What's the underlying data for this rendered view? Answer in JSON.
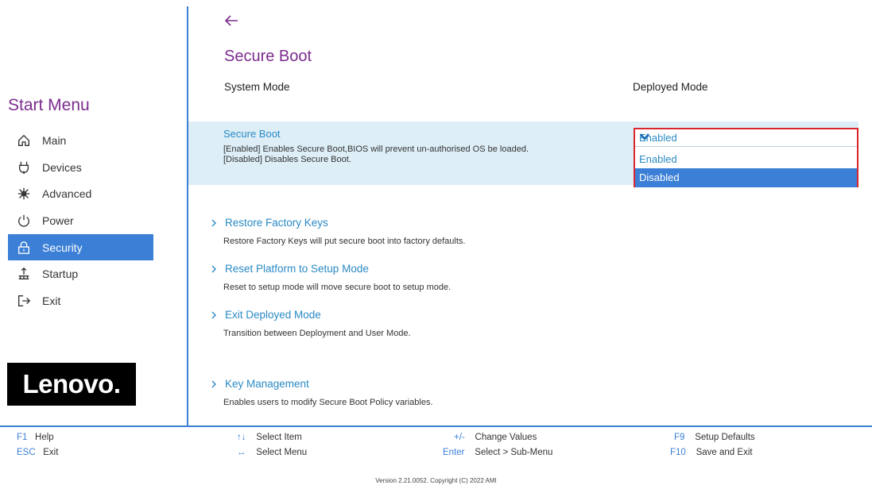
{
  "sidebar": {
    "title": "Start Menu",
    "items": [
      {
        "label": "Main",
        "icon": "home-icon"
      },
      {
        "label": "Devices",
        "icon": "devices-icon"
      },
      {
        "label": "Advanced",
        "icon": "advanced-icon"
      },
      {
        "label": "Power",
        "icon": "power-icon"
      },
      {
        "label": "Security",
        "icon": "security-icon",
        "active": true
      },
      {
        "label": "Startup",
        "icon": "startup-icon"
      },
      {
        "label": "Exit",
        "icon": "exit-icon"
      }
    ],
    "logo": "Lenovo."
  },
  "page": {
    "title": "Secure Boot",
    "system_mode_label": "System Mode",
    "system_mode_value": "Deployed Mode"
  },
  "secure_boot": {
    "title": "Secure Boot",
    "desc_line1": "[Enabled] Enables Secure Boot,BIOS will prevent un-authorised OS be loaded.",
    "desc_line2": "[Disabled] Disables Secure Boot.",
    "current_value": "Enabled",
    "options": [
      "Enabled",
      "Disabled"
    ],
    "highlighted_option": "Disabled"
  },
  "links": [
    {
      "label": "Restore Factory Keys",
      "desc": "Restore Factory Keys will put secure boot into factory defaults."
    },
    {
      "label": "Reset Platform to Setup Mode",
      "desc": "Reset to setup mode will move secure boot to setup mode."
    },
    {
      "label": "Exit Deployed Mode",
      "desc": "Transition between Deployment and User Mode."
    },
    {
      "label": "Key Management",
      "desc": "Enables users to modify Secure Boot Policy variables."
    }
  ],
  "footer": {
    "keys": [
      {
        "key": "F1",
        "text": "Help"
      },
      {
        "key": "ESC",
        "text": "Exit"
      },
      {
        "key": "↑↓",
        "text": "Select Item"
      },
      {
        "key": "↔",
        "text": "Select Menu"
      },
      {
        "key": "+/-",
        "text": "Change Values"
      },
      {
        "key": "Enter",
        "text": "Select > Sub-Menu"
      },
      {
        "key": "F9",
        "text": "Setup Defaults"
      },
      {
        "key": "F10",
        "text": "Save and Exit"
      }
    ],
    "version": "Version 2.21.0052. Copyright (C) 2022 AMI"
  },
  "colors": {
    "accent": "#3b7fd6",
    "title_purple": "#7b2d8e",
    "link_blue": "#2a8ac4",
    "highlight_row": "#ddeef7",
    "dropdown_border": "#d9262e"
  }
}
